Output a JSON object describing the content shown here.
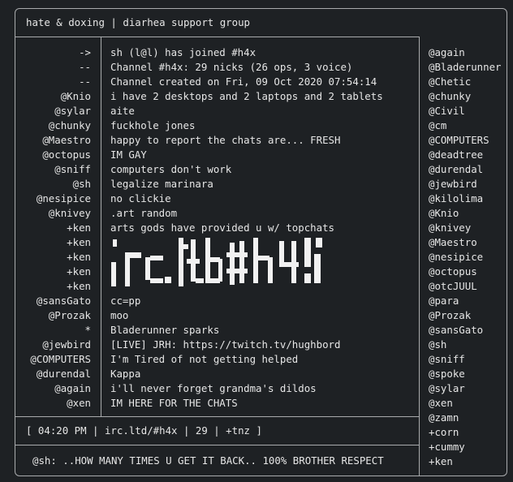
{
  "window": {
    "title": "hate & doxing | diarhea support group"
  },
  "messages": [
    {
      "nick": "->",
      "text": "sh (l@l) has joined #h4x"
    },
    {
      "nick": "--",
      "text": "Channel #h4x: 29 nicks (26 ops, 3 voice)"
    },
    {
      "nick": "--",
      "text": "Channel created on Fri, 09 Oct 2020 07:54:14"
    },
    {
      "nick": "@Knio",
      "text": "i have 2 desktops and 2 laptops and 2 tablets"
    },
    {
      "nick": "@sylar",
      "text": "aite"
    },
    {
      "nick": "@chunky",
      "text": "fuckhole jones"
    },
    {
      "nick": "@Maestro",
      "text": "happy to report the chats are... FRESH"
    },
    {
      "nick": "@octopus",
      "text": "IM GAY"
    },
    {
      "nick": "@sniff",
      "text": "computers don't work"
    },
    {
      "nick": "@sh",
      "text": "legalize marinara"
    },
    {
      "nick": "@nesipice",
      "text": "no clickie"
    },
    {
      "nick": "@knivey",
      "text": ".art random"
    },
    {
      "nick": "+ken",
      "text": "arts gods have provided u w/ topchats"
    },
    {
      "nick": "+ken",
      "text": ""
    },
    {
      "nick": "+ken",
      "text": ""
    },
    {
      "nick": "+ken",
      "text": ""
    },
    {
      "nick": "+ken",
      "text": ""
    },
    {
      "nick": "@sansGato",
      "text": "cc=pp"
    },
    {
      "nick": "@Prozak",
      "text": "moo"
    },
    {
      "nick": "*",
      "text": "Bladerunner sparks"
    },
    {
      "nick": "@jewbird",
      "text": "[LIVE] JRH: https://twitch.tv/hughbord"
    },
    {
      "nick": "@COMPUTERS",
      "text": "I'm Tired of not getting helped"
    },
    {
      "nick": "@durendal",
      "text": "Kappa"
    },
    {
      "nick": "@again",
      "text": "i'll never forget grandma's dildos"
    },
    {
      "nick": "@xen",
      "text": "IM HERE FOR THE CHATS"
    }
  ],
  "ascii_art": {
    "text": "irc.ltd #h4x"
  },
  "nicklist": [
    "@again",
    "@Bladerunner",
    "@Chetic",
    "@chunky",
    "@Civil",
    "@cm",
    "@COMPUTERS",
    "@deadtree",
    "@durendal",
    "@jewbird",
    "@kilolima",
    "@Knio",
    "@knivey",
    "@Maestro",
    "@nesipice",
    "@octopus",
    "@otcJUUL",
    "@para",
    "@Prozak",
    "@sansGato",
    "@sh",
    "@sniff",
    "@spoke",
    "@sylar",
    "@xen",
    "@zamn",
    "+corn",
    "+cummy",
    "+ken"
  ],
  "status": {
    "text": "[ 04:20 PM | irc.ltd/#h4x | 29 | +tnz ]"
  },
  "input": {
    "text": "@sh: ..HOW MANY TIMES U GET IT BACK.. 100% BROTHER RESPECT"
  }
}
